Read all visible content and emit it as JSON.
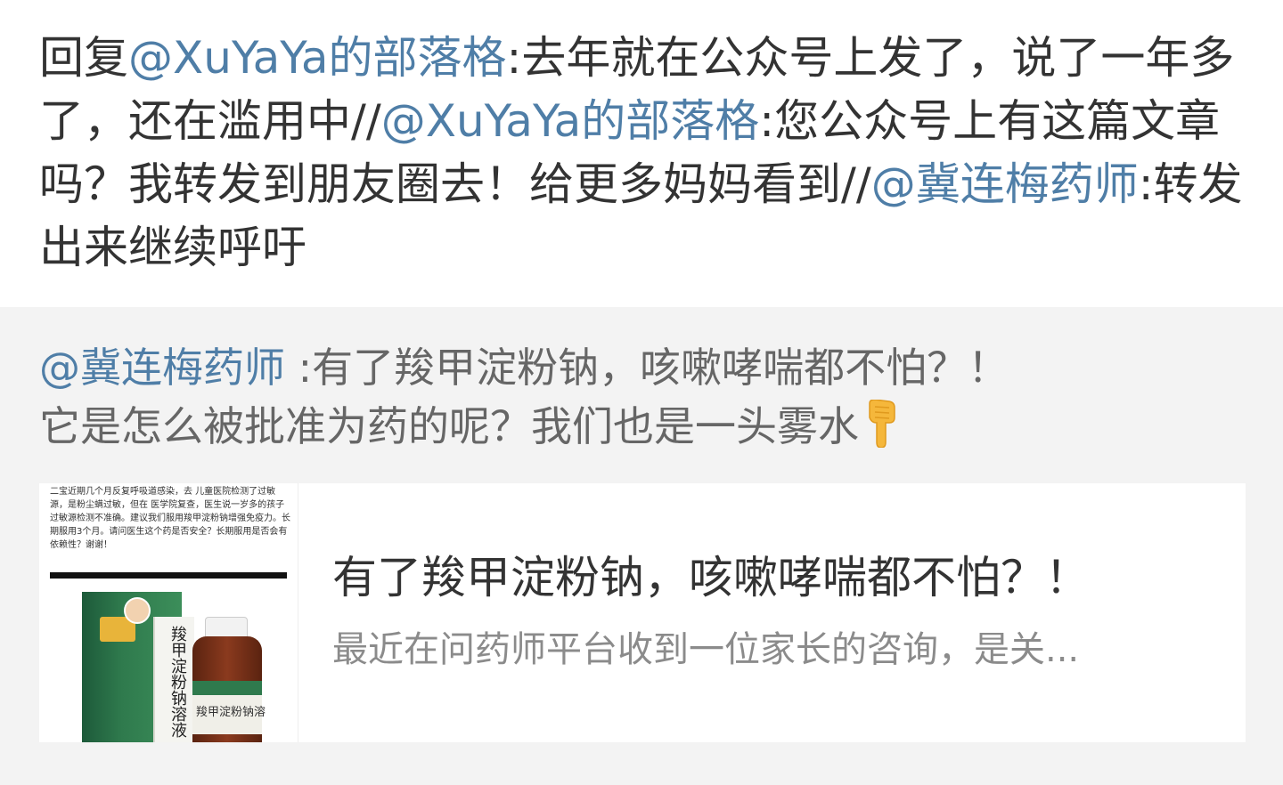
{
  "post": {
    "prefix": "回复",
    "mention1": "@XuYaYa的部落格",
    "text1": ":去年就在公众号上发了，说了一年多了，还在滥用中//",
    "mention2": "@XuYaYa的部落格",
    "text2": ":您公众号上有这篇文章吗？我转发到朋友圈去！给更多妈妈看到//",
    "mention3": "@冀连梅药师",
    "text3": ":转发出来继续呼吁"
  },
  "retweet": {
    "author": "@冀连梅药师",
    "text": " :有了羧甲淀粉钠，咳嗽哮喘都不怕？！\n它是怎么被批准为药的呢？我们也是一头雾水",
    "emoji": "pointing-down-hand-icon"
  },
  "card": {
    "title": "有了羧甲淀粉钠，咳嗽哮喘都不怕？！",
    "summary": "最近在问药师平台收到一位家长的咨询，是关...",
    "thumbnail_note": "二宝近期几个月反复呼吸道感染，去 儿童医院检测了过敏源，是粉尘螨过敏，但在 医学院复查，医生说一岁多的孩子过敏源检测不准确。建议我们服用羧甲淀粉钠增强免疫力。长期服用3个月。请问医生这个药是否安全？长期服用是否会有依赖性？谢谢！",
    "box_text": "羧甲淀粉钠溶液",
    "bottle_text": "羧甲淀粉钠溶"
  },
  "colors": {
    "mention": "#4f7ea7",
    "text": "#333333",
    "retweet_bg": "#f3f3f3",
    "summary": "#8b8b8b"
  }
}
